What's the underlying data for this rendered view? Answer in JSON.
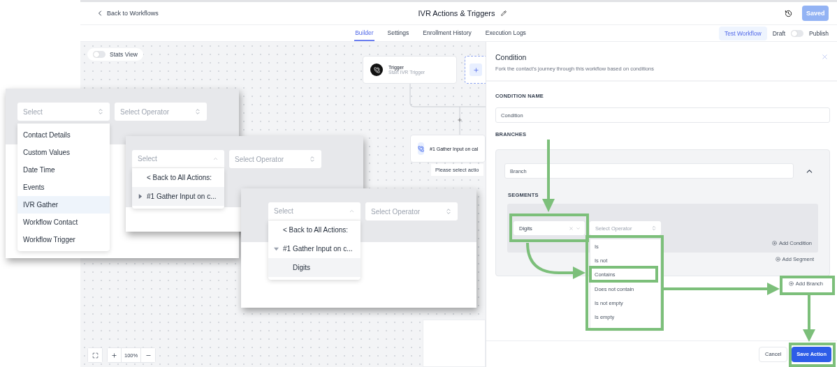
{
  "header": {
    "back_link": "Back to Workflows",
    "title": "IVR Actions & Triggers",
    "save_status": "Saved"
  },
  "tabs": [
    {
      "label": "Builder",
      "selected": true
    },
    {
      "label": "Settings",
      "selected": false
    },
    {
      "label": "Enrollment History",
      "selected": false
    },
    {
      "label": "Execution Logs",
      "selected": false
    }
  ],
  "toolbar": {
    "test_button": "Test Workflow",
    "publish": {
      "off_label": "Draft",
      "on_label": "Publish",
      "on": false
    }
  },
  "canvas": {
    "stats_view": {
      "label": "Stats View",
      "on": false
    },
    "nodes": [
      {
        "kind": "trigger",
        "title": "Trigger",
        "subtitle": "Start IVR Trigger"
      },
      {
        "kind": "action",
        "title": "#1 Gather Input on cal"
      }
    ],
    "hint": "Please select actio",
    "zoom": "100%"
  },
  "panel": {
    "title": "Condition",
    "subtitle": "Fork the contact's journey through this workflow based on conditions",
    "condition_name_label": "CONDITION NAME",
    "condition_name": "Condition",
    "branches_label": "BRANCHES",
    "branch": {
      "name": "Branch",
      "expanded": true,
      "segments_label": "SEGMENTS",
      "field": "Digits",
      "operator_placeholder": "Select Operator",
      "operators": [
        "Is",
        "Is not",
        "Contains",
        "Does not contain",
        "Is not empty",
        "Is empty"
      ],
      "add_condition": "Add Condition",
      "add_segment": "Add Segment"
    },
    "add_branch": "Add Branch",
    "cancel": "Cancel",
    "save": "Save Action"
  },
  "insets": [
    {
      "field_placeholder": "Select",
      "operator_placeholder": "Select Operator",
      "options": [
        {
          "kind": "category",
          "label": "Contact Details",
          "highlighted": false
        },
        {
          "kind": "category",
          "label": "Custom Values",
          "highlighted": false
        },
        {
          "kind": "category",
          "label": "Date Time",
          "highlighted": false
        },
        {
          "kind": "category",
          "label": "Events",
          "highlighted": false
        },
        {
          "kind": "category",
          "label": "IVR Gather",
          "highlighted": true
        },
        {
          "kind": "category",
          "label": "Workflow Contact",
          "highlighted": false
        },
        {
          "kind": "category",
          "label": "Workflow Trigger",
          "highlighted": false
        }
      ]
    },
    {
      "field_placeholder": "Select",
      "operator_placeholder": "Select Operator",
      "options": [
        {
          "kind": "back",
          "label": "< Back to All Actions:",
          "highlighted": false
        },
        {
          "kind": "group",
          "label": "#1 Gather Input on c...",
          "highlighted": true,
          "expanded": false
        }
      ]
    },
    {
      "field_placeholder": "Select",
      "operator_placeholder": "Select Operator",
      "options": [
        {
          "kind": "back",
          "label": "< Back to All Actions:",
          "highlighted": false
        },
        {
          "kind": "group",
          "label": "#1 Gather Input on c...",
          "highlighted": false,
          "expanded": true
        },
        {
          "kind": "leaf",
          "label": "Digits",
          "highlighted": true
        }
      ]
    }
  ]
}
